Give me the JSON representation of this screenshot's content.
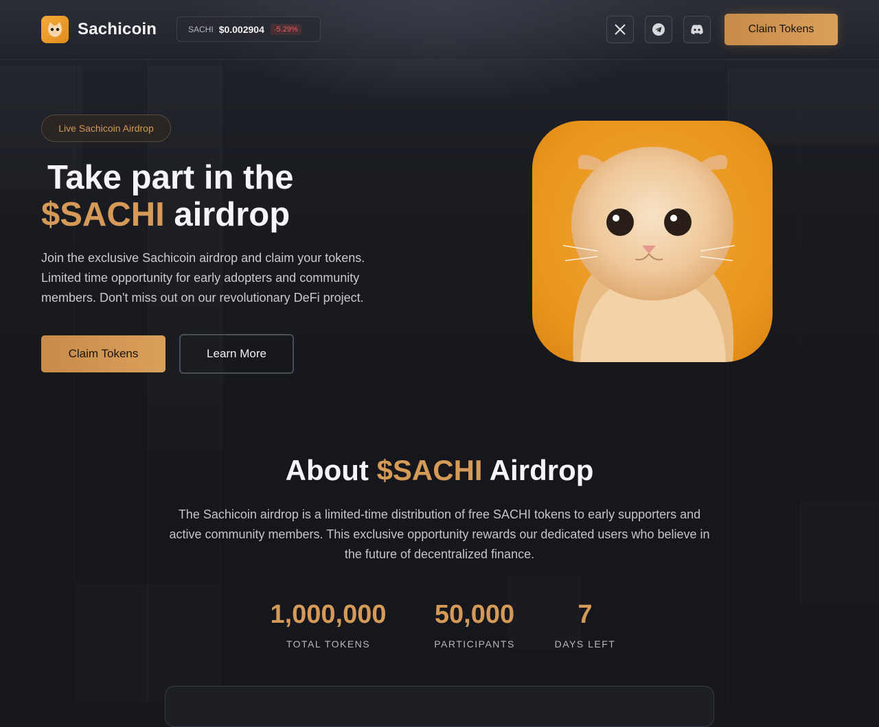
{
  "header": {
    "brand": "Sachicoin",
    "logo_icon": "cat-logo-icon",
    "ticker": {
      "symbol": "SACHI",
      "price": "$0.002904",
      "change": "-5.29%",
      "change_color": "#ef5a5a"
    },
    "social": [
      {
        "name": "x-icon",
        "label": "X"
      },
      {
        "name": "telegram-icon",
        "label": "Telegram"
      },
      {
        "name": "discord-icon",
        "label": "Discord"
      }
    ],
    "cta_label": "Claim Tokens"
  },
  "hero": {
    "badge": "Live Sachicoin Airdrop",
    "title_line1": "Take part in the",
    "title_accent": "$SACHI",
    "title_rest": " airdrop",
    "description": "Join the exclusive Sachicoin airdrop and claim your tokens. Limited time opportunity for early adopters and community members. Don't miss out on our revolutionary DeFi project.",
    "primary_button": "Claim Tokens",
    "secondary_button": "Learn More",
    "image_icon": "kitten-image"
  },
  "about": {
    "title_prefix": "About ",
    "title_accent": "$SACHI",
    "title_suffix": " Airdrop",
    "description": "The Sachicoin airdrop is a limited-time distribution of free SACHI tokens to early supporters and active community members. This exclusive opportunity rewards our dedicated users who believe in the future of decentralized finance.",
    "stats": [
      {
        "value": "1,000,000",
        "label": "TOTAL TOKENS"
      },
      {
        "value": "50,000",
        "label": "PARTICIPANTS"
      },
      {
        "value": "7",
        "label": "DAYS LEFT"
      }
    ]
  },
  "colors": {
    "accent": "#d59a58",
    "background": "#16181e",
    "button_gradient_start": "#c88b4a",
    "button_gradient_end": "#d9a05b"
  }
}
